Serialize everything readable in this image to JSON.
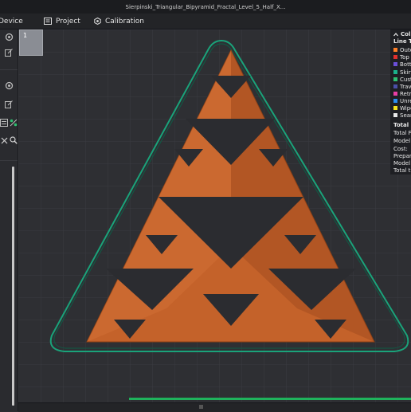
{
  "window": {
    "title": "Sierpinski_Triangular_Bipyramid_Fractal_Level_5_Half_X..."
  },
  "menu": {
    "device": "Device",
    "project": "Project",
    "calibration": "Calibration"
  },
  "plate": {
    "number": "1"
  },
  "legend": {
    "title": "Col",
    "subtitle": "Line Ty",
    "items": [
      {
        "label": "Oute",
        "color": "#ff7f27"
      },
      {
        "label": "Top s",
        "color": "#e0302e"
      },
      {
        "label": "Botto",
        "color": "#6b4fd8"
      },
      {
        "label": "Skirt",
        "color": "#1bb08a"
      },
      {
        "label": "Custo",
        "color": "#2fbf71"
      },
      {
        "label": "Trave",
        "color": "#4a4fa8"
      },
      {
        "label": "Retra",
        "color": "#e83ea5"
      },
      {
        "label": "Unre",
        "color": "#2b8ef0"
      },
      {
        "label": "Wipe",
        "color": "#f5e11d"
      },
      {
        "label": "Seam",
        "color": "#e8e8e8"
      }
    ],
    "stats_title": "Total E",
    "stats": [
      "Total F",
      "Model",
      "Cost:",
      "Prepare",
      "Model p",
      "Total ti"
    ]
  },
  "colors": {
    "model": "#c4622a",
    "skirt": "#1aa37a",
    "progress": "#1fb35c",
    "background": "#2e2f33"
  },
  "status": {
    "progress_fraction": 0.69
  }
}
